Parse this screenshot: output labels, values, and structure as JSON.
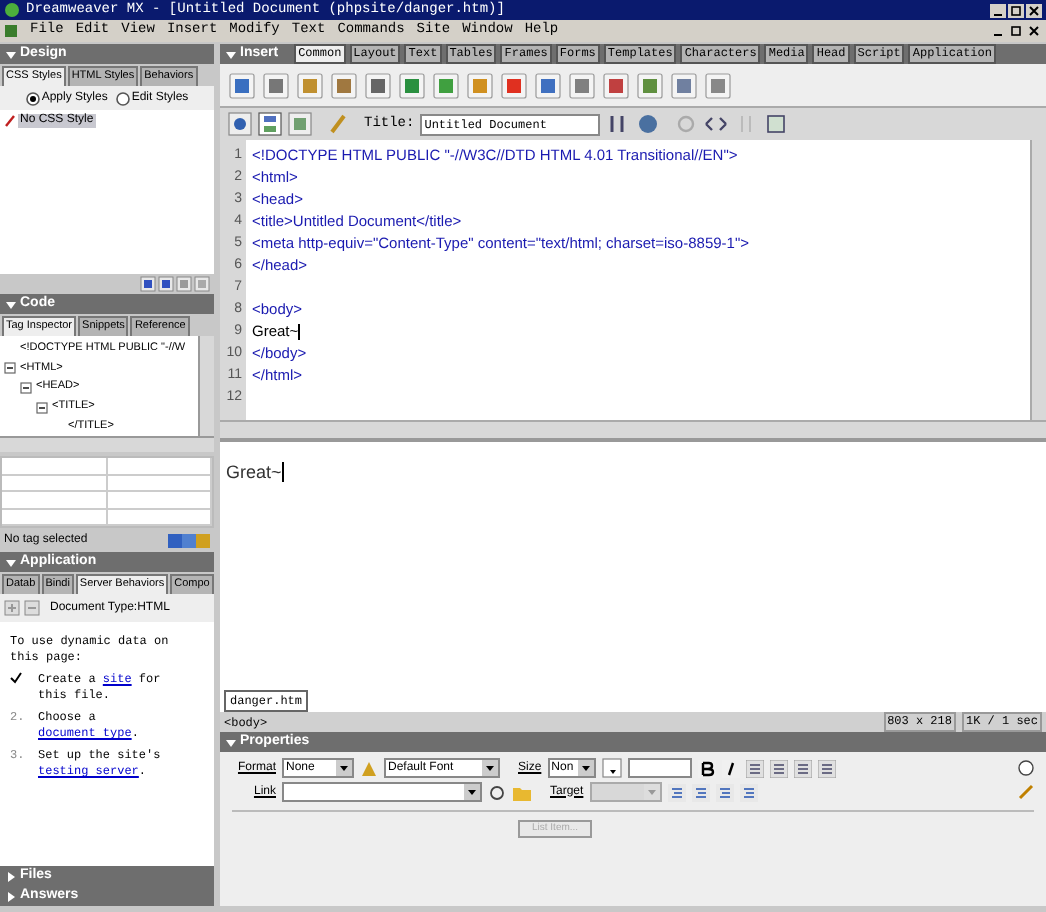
{
  "window": {
    "title": "Dreamweaver MX - [Untitled Document (phpsite/danger.htm)]"
  },
  "menu": [
    "File",
    "Edit",
    "View",
    "Insert",
    "Modify",
    "Text",
    "Commands",
    "Site",
    "Window",
    "Help"
  ],
  "design_panel": {
    "title": "Design",
    "tabs": [
      {
        "label": "CSS Styles",
        "selected": true
      },
      {
        "label": "HTML Styles",
        "selected": false
      },
      {
        "label": "Behaviors",
        "selected": false
      }
    ],
    "radios": [
      {
        "label": "Apply Styles",
        "selected": true
      },
      {
        "label": "Edit Styles",
        "selected": false
      }
    ],
    "styles": [
      {
        "label": "No CSS Style",
        "selected": true
      }
    ]
  },
  "code_panel": {
    "title": "Code",
    "tabs": [
      {
        "label": "Tag Inspector",
        "selected": true
      },
      {
        "label": "Snippets",
        "selected": false
      },
      {
        "label": "Reference",
        "selected": false
      }
    ],
    "tree": [
      {
        "label": "<!DOCTYPE HTML PUBLIC \"-//W"
      },
      {
        "label": "<HTML>",
        "expanded": true,
        "children": [
          {
            "label": "<HEAD>",
            "expanded": true,
            "children": [
              {
                "label": "<TITLE>",
                "expanded": true,
                "children": [
                  {
                    "label": "</TITLE>"
                  }
                ]
              }
            ]
          }
        ]
      }
    ],
    "status": "No tag selected"
  },
  "application_panel": {
    "title": "Application",
    "tabs": [
      {
        "label": "Datab",
        "selected": false
      },
      {
        "label": "Bindi",
        "selected": false
      },
      {
        "label": "Server Behaviors",
        "selected": true
      },
      {
        "label": "Compo",
        "selected": false
      }
    ],
    "document_type": "Document Type:HTML",
    "intro": "To use dynamic data on this page:",
    "steps": [
      {
        "done": true,
        "before": "Create a ",
        "link": "site",
        "after": " for this file."
      },
      {
        "done": false,
        "marker": "2.",
        "before": "Choose a ",
        "link": "document type",
        "after": "."
      },
      {
        "done": false,
        "marker": "3.",
        "before": "Set up the site's ",
        "link": "testing server",
        "after": "."
      }
    ]
  },
  "collapsed_panels": [
    {
      "title": "Files",
      "expanded": false
    },
    {
      "title": "Answers",
      "expanded": false
    }
  ],
  "insert_panel": {
    "title": "Insert",
    "tabs": [
      {
        "label": "Common",
        "selected": true
      },
      {
        "label": "Layout",
        "selected": false
      },
      {
        "label": "Text",
        "selected": false
      },
      {
        "label": "Tables",
        "selected": false
      },
      {
        "label": "Frames",
        "selected": false
      },
      {
        "label": "Forms",
        "selected": false
      },
      {
        "label": "Templates",
        "selected": false
      },
      {
        "label": "Characters",
        "selected": false
      },
      {
        "label": "Media",
        "selected": false
      },
      {
        "label": "Head",
        "selected": false
      },
      {
        "label": "Script",
        "selected": false
      },
      {
        "label": "Application",
        "selected": false
      }
    ]
  },
  "document_toolbar": {
    "title_label": "Title:",
    "title_value": "Untitled Document"
  },
  "code_lines": [
    {
      "number": "1",
      "text": "<!DOCTYPE HTML PUBLIC \"-//W3C//DTD HTML 4.01 Transitional//EN\">"
    },
    {
      "number": "2",
      "text": "<html>"
    },
    {
      "number": "3",
      "text": "<head>"
    },
    {
      "number": "4",
      "text": "<title>Untitled Document</title>"
    },
    {
      "number": "5",
      "text": "<meta http-equiv=\"Content-Type\" content=\"text/html; charset=iso-8859-1\">"
    },
    {
      "number": "6",
      "text": "</head>"
    },
    {
      "number": "7"
    },
    {
      "number": "8",
      "text": "<body>"
    },
    {
      "number": "9",
      "text": "Great~",
      "kind": "content"
    },
    {
      "number": "10",
      "text": "</body>"
    },
    {
      "number": "11",
      "text": "</html>"
    },
    {
      "number": "12"
    }
  ],
  "design_view": {
    "text": "Great~"
  },
  "document_tabs": [
    {
      "label": "danger.htm",
      "selected": true
    }
  ],
  "status_bar": {
    "tag": "<body>",
    "size": "803 x 218",
    "download": "1K / 1 sec"
  },
  "properties": {
    "title": "Properties",
    "format_label": "Format",
    "format": "None",
    "font": "Default Font",
    "size_label": "Size",
    "size": "Non",
    "link_label": "Link",
    "target_label": "Target",
    "button": "List Item...",
    "button_disabled": true
  }
}
